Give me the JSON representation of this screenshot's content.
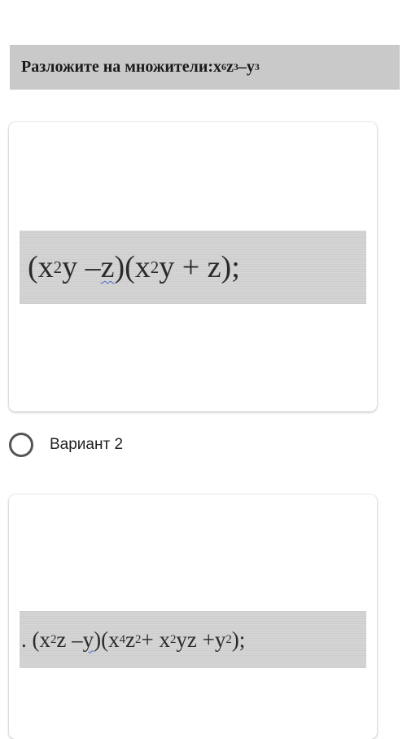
{
  "question": {
    "prefix": "Разложите на множители: ",
    "base_x": "x",
    "exp_x": "6",
    "base_z": "z",
    "exp_z": "3",
    "minus": " – ",
    "base_y": "y",
    "exp_y": "3"
  },
  "option_1_image": {
    "open1": "(x",
    "e1": "2",
    "mid1": "y – ",
    "sq": "z",
    "mid2": ")(x",
    "e2": "2",
    "tail": "y + z);"
  },
  "option_2": {
    "label": "Вариант 2"
  },
  "option_2_image": {
    "lead": ". (x",
    "e1": "2",
    "m1": "z – ",
    "sq": "y",
    "m2": ")(x",
    "e2": "4",
    "m3": "z",
    "e3": "2",
    "m4": " + x",
    "e4": "2",
    "m5": "yz +y",
    "e5": "2",
    "tail": ");"
  }
}
